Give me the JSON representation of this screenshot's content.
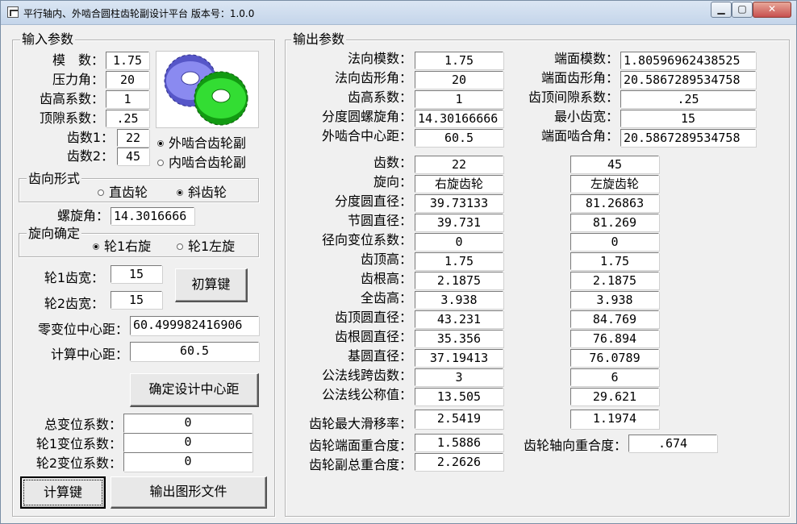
{
  "window": {
    "title": "平行轴内、外啮合圆柱齿轮副设计平台 版本号：1.0.0",
    "minimize": "0",
    "maximize": "1",
    "close": "r"
  },
  "input": {
    "legend": "输入参数",
    "module_label": "模　数：",
    "module": "1.75",
    "pressure_angle_label": "压力角：",
    "pressure_angle": "20",
    "addendum_coef_label": "齿高系数：",
    "addendum_coef": "1",
    "clearance_coef_label": "顶隙系数：",
    "clearance_coef": ".25",
    "teeth1_label": "齿数1：",
    "teeth1": "22",
    "teeth2_label": "齿数2：",
    "teeth2": "45",
    "mesh_external": "外啮合齿轮副",
    "mesh_internal": "内啮合齿轮副",
    "tooth_form_legend": "齿向形式",
    "spur": "直齿轮",
    "helical": "斜齿轮",
    "helix_angle_label": "螺旋角：",
    "helix_angle": "14.3016666",
    "hand_legend": "旋向确定",
    "gear1_right": "轮1右旋",
    "gear1_left": "轮1左旋",
    "width1_label": "轮1齿宽：",
    "width1": "15",
    "width2_label": "轮2齿宽：",
    "width2": "15",
    "preliminary_button": "初算键",
    "zero_shift_center_label": "零变位中心距：",
    "zero_shift_center": "60.499982416906",
    "calc_center_label": "计算中心距：",
    "calc_center": "60.5",
    "confirm_center_button": "确定设计中心距",
    "total_shift_label": "总变位系数：",
    "total_shift": "0",
    "shift1_label": "轮1变位系数：",
    "shift1": "0",
    "shift2_label": "轮2变位系数：",
    "shift2": "0",
    "calc_button": "计算键",
    "export_button": "输出图形文件"
  },
  "output": {
    "legend": "输出参数",
    "normal_module_label": "法向模数：",
    "normal_module": "1.75",
    "normal_pressure_label": "法向齿形角：",
    "normal_pressure": "20",
    "addendum_coef_label": "齿高系数：",
    "addendum_coef": "1",
    "helix_label": "分度圆螺旋角：",
    "helix": "14.30166666",
    "ext_center_label": "外啮合中心距：",
    "ext_center": "60.5",
    "transverse_module_label": "端面模数：",
    "transverse_module": "1.80596962438525",
    "transverse_pressure_label": "端面齿形角：",
    "transverse_pressure": "20.5867289534758",
    "clearance_label": "齿顶间隙系数：",
    "clearance": ".25",
    "min_width_label": "最小齿宽：",
    "min_width": "15",
    "transverse_mesh_label": "端面啮合角：",
    "transverse_mesh": "20.5867289534758",
    "rows": [
      {
        "label": "齿数：",
        "g1": "22",
        "g2": "45"
      },
      {
        "label": "旋向：",
        "g1": "右旋齿轮",
        "g2": "左旋齿轮"
      },
      {
        "label": "分度圆直径：",
        "g1": "39.73133",
        "g2": "81.26863"
      },
      {
        "label": "节圆直径：",
        "g1": "39.731",
        "g2": "81.269"
      },
      {
        "label": "径向变位系数：",
        "g1": "0",
        "g2": "0"
      },
      {
        "label": "齿顶高：",
        "g1": "1.75",
        "g2": "1.75"
      },
      {
        "label": "齿根高：",
        "g1": "2.1875",
        "g2": "2.1875"
      },
      {
        "label": "全齿高：",
        "g1": "3.938",
        "g2": "3.938"
      },
      {
        "label": "齿顶圆直径：",
        "g1": "43.231",
        "g2": "84.769"
      },
      {
        "label": "齿根圆直径：",
        "g1": "35.356",
        "g2": "76.894"
      },
      {
        "label": "基圆直径：",
        "g1": "37.19413",
        "g2": "76.0789"
      },
      {
        "label": "公法线跨齿数：",
        "g1": "3",
        "g2": "6"
      },
      {
        "label": "公法线公称值：",
        "g1": "13.505",
        "g2": "29.621"
      }
    ],
    "max_slide_label": "齿轮最大滑移率：",
    "max_slide1": "2.5419",
    "max_slide2": "1.1974",
    "transverse_contact_label": "齿轮端面重合度：",
    "transverse_contact": "1.5886",
    "axial_contact_label": "齿轮轴向重合度：",
    "axial_contact": ".674",
    "total_contact_label": "齿轮副总重合度：",
    "total_contact": "2.2626"
  },
  "icons": {
    "gears": "gears-icon"
  },
  "colors": {
    "gear_blue": "#6b6be0",
    "gear_green": "#22cc22",
    "window_bg": "#f0f0f0"
  }
}
